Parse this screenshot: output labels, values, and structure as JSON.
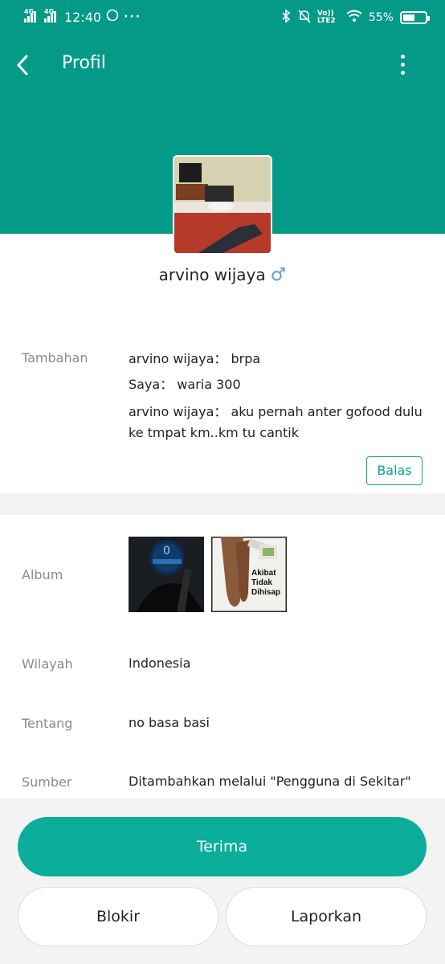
{
  "status_bar": {
    "network_1": "4G",
    "network_2": "4G",
    "time": "12:40",
    "volte": "Vo)) LTE2",
    "battery": "55%",
    "battery_level": 0.55
  },
  "nav": {
    "title": "Profil"
  },
  "profile": {
    "name": "arvino wijaya",
    "gender_symbol": "♂"
  },
  "tambahan": {
    "label": "Tambahan",
    "messages": [
      "arvino wijaya： brpa",
      "Saya： waria 300",
      "arvino wijaya： aku pernah anter gofood dulu ke tmpat km..km tu cantik"
    ],
    "reply_label": "Balas"
  },
  "album": {
    "label": "Album",
    "photo_2_caption": [
      "Akibat",
      "Tidak",
      "Dihisap"
    ]
  },
  "wilayah": {
    "label": "Wilayah",
    "value": "Indonesia"
  },
  "tentang": {
    "label": "Tentang",
    "value": "no basa basi"
  },
  "sumber": {
    "label": "Sumber",
    "value": "Ditambahkan melalui \"Pengguna di Sekitar\""
  },
  "actions": {
    "accept": "Terima",
    "block": "Blokir",
    "report": "Laporkan"
  },
  "colors": {
    "header": "#049a88",
    "accent": "#0aae9b",
    "male_icon": "#5aa0e0"
  }
}
